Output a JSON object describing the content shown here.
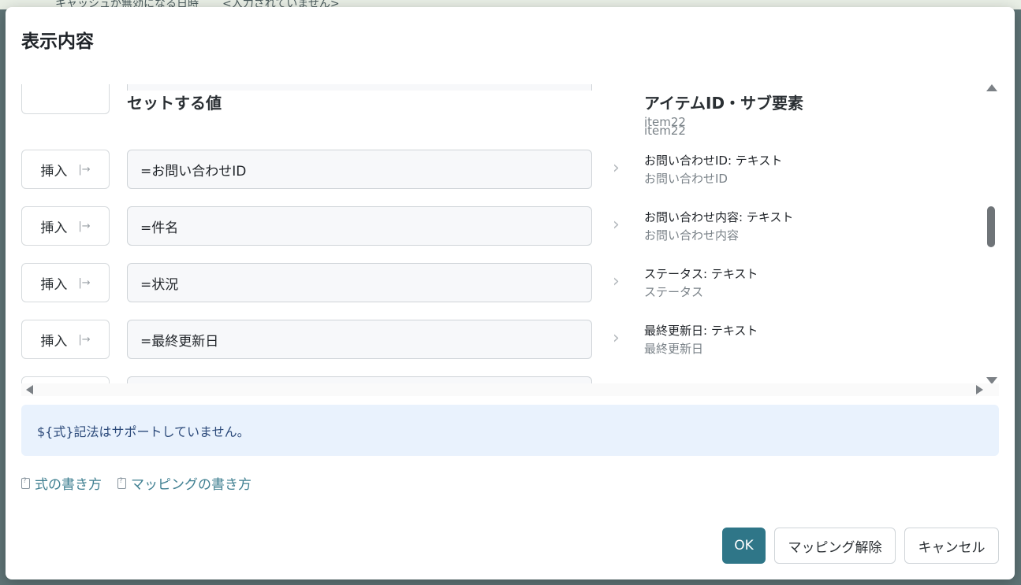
{
  "background": {
    "text1": "キャッシュが無効になる日時",
    "text2": "<入力されていません>"
  },
  "dialog": {
    "title": "表示内容",
    "headers": {
      "value": "セットする値",
      "item": "アイテムID・サブ要素"
    },
    "partial_top_row": {
      "item_sub": "item22"
    },
    "rows": [
      {
        "insert_label": "挿入",
        "value": "=お問い合わせID",
        "item_name": "お問い合わせID: テキスト",
        "item_sub": "お問い合わせID"
      },
      {
        "insert_label": "挿入",
        "value": "=件名",
        "item_name": "お問い合わせ内容: テキスト",
        "item_sub": "お問い合わせ内容"
      },
      {
        "insert_label": "挿入",
        "value": "=状況",
        "item_name": "ステータス: テキスト",
        "item_sub": "ステータス"
      },
      {
        "insert_label": "挿入",
        "value": "=最終更新日",
        "item_name": "最終更新日: テキスト",
        "item_sub": "最終更新日"
      }
    ],
    "info_banner": "${式}記法はサポートしていません。",
    "help_links": {
      "formula": "式の書き方",
      "mapping": "マッピングの書き方"
    },
    "buttons": {
      "ok": "OK",
      "unmap": "マッピング解除",
      "cancel": "キャンセル"
    }
  },
  "colors": {
    "primary": "#2f7688",
    "info_bg": "#e9f2fd",
    "link": "#3f7f91"
  }
}
